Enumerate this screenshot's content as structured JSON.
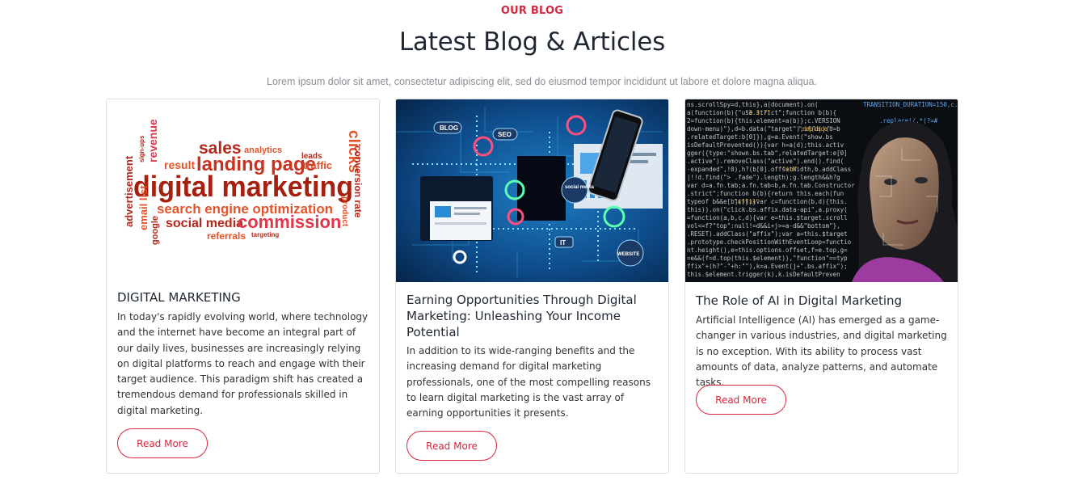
{
  "section": {
    "eyebrow": "OUR BLOG",
    "title": "Latest Blog & Articles",
    "subtitle": "Lorem ipsum dolor sit amet, consectetur adipiscing elit, sed do eiusmod tempor incididunt ut labore et dolore magna aliqua."
  },
  "colors": {
    "accent": "#d7263d",
    "heading": "#1f2733",
    "border": "#dedede"
  },
  "posts": [
    {
      "title": "DIGITAL MARKETING",
      "excerpt": "In today's rapidly evolving world, where technology and the internet have become an integral part of our daily lives, businesses are increasingly relying on digital platforms to reach and engage with their target audience. This paradigm shift has created a tremendous demand for professionals skilled in digital marketing.",
      "button": "Read More",
      "image": {
        "kind": "word-cloud",
        "words": {
          "main": "digital marketing",
          "sales": "sales",
          "analytics": "analytics",
          "landing": "landing page",
          "result": "result",
          "leads": "leads",
          "traffic": "traffic",
          "clicks": "clicks",
          "conversion": "conversion rate",
          "product": "product",
          "seo": "search engine optimization",
          "social": "social media",
          "commission": "commission",
          "referrals": "referrals",
          "targeting": "targeting",
          "revenue": "revenue",
          "signups": "sign-ups",
          "advertisement": "advertisement",
          "email": "email list",
          "google": "google"
        }
      }
    },
    {
      "title": "Earning Opportunities Through Digital Marketing: Unleashing Your Income Potential",
      "excerpt": "In addition to its wide-ranging benefits and the increasing demand for digital marketing professionals, one of the most compelling reasons to learn digital marketing is the vast array of earning opportunities it presents.",
      "button": "Read More",
      "image": {
        "kind": "tech-network",
        "labels": {
          "blog": "BLOG",
          "seo": "SEO",
          "social": "social media",
          "it": "IT",
          "website": "WEBSITE"
        }
      }
    },
    {
      "title": "The Role of AI in Digital Marketing",
      "excerpt": "Artificial Intelligence (AI) has emerged as a game-changer in various industries, and digital marketing is no exception. With its ability to process vast amounts of data, analyze patterns, and automate tasks,",
      "button": "Read More",
      "image": {
        "kind": "ai-code-face"
      }
    }
  ]
}
